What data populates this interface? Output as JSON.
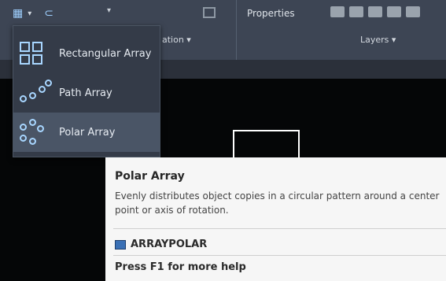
{
  "ribbon": {
    "panel_title_mid": "ation ▾",
    "properties_label": "Properties",
    "layers_label": "Layers ▾"
  },
  "dropdown": {
    "items": [
      {
        "label": "Rectangular Array",
        "icon": "rectangular-array-icon"
      },
      {
        "label": "Path Array",
        "icon": "path-array-icon"
      },
      {
        "label": "Polar Array",
        "icon": "polar-array-icon",
        "highlighted": true
      }
    ]
  },
  "tooltip": {
    "title": "Polar Array",
    "description": "Evenly distributes object copies in a circular pattern around a center point or axis of rotation.",
    "command": "ARRAYPOLAR",
    "help": "Press F1 for more help"
  },
  "colors": {
    "ribbon": "#3d4554",
    "dropdown_bg": "#343b48",
    "highlight": "#4a5566",
    "icon_blue": "#a8d6ff",
    "canvas": "#050607"
  }
}
